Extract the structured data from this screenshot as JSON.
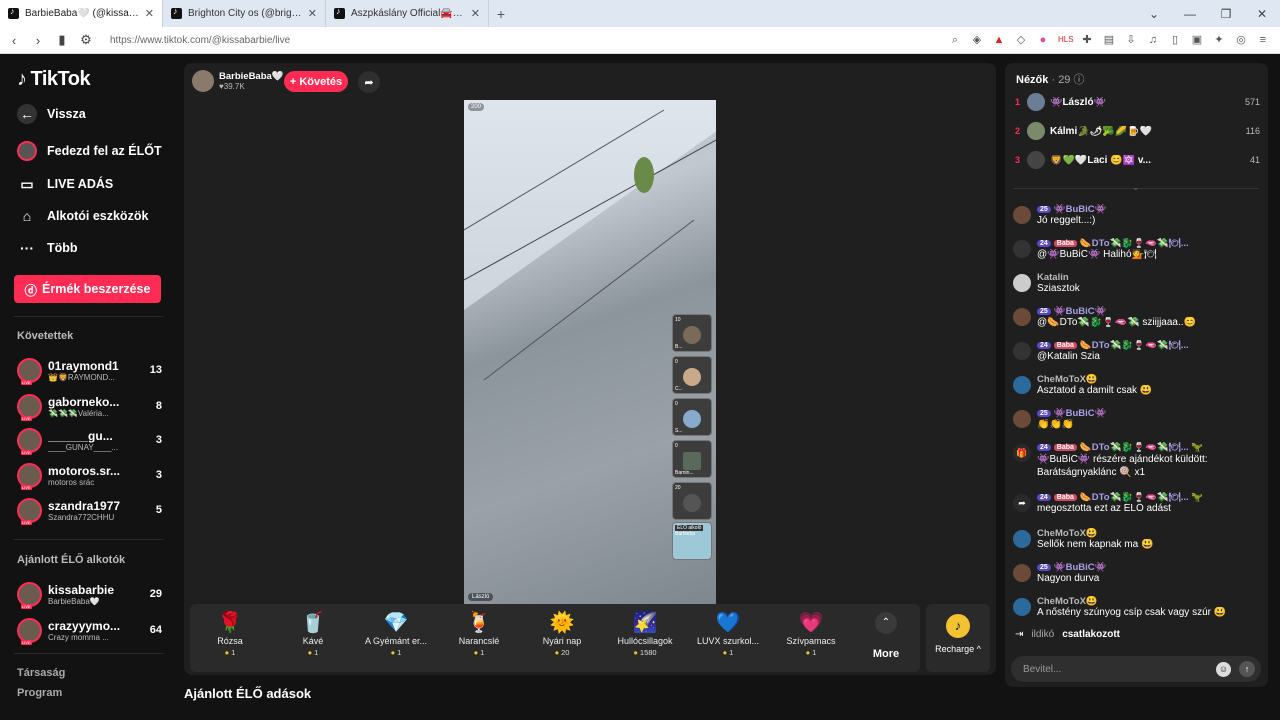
{
  "browser": {
    "tabs": [
      {
        "label": "BarbieBaba🤍 (@kissabarbie"
      },
      {
        "label": "Brighton City os (@brighton.city) ÉLŐ"
      },
      {
        "label": "Aszpkáslány Official🚘✖️ (@theresi"
      }
    ],
    "new_tab": "+",
    "url": "https://www.tiktok.com/@kissabarbie/live"
  },
  "sidebar": {
    "logo": "TikTok",
    "back": "Vissza",
    "nav": [
      {
        "label": "Fedezd fel az ÉLŐT",
        "icon": "live-explore-icon"
      },
      {
        "label": "LIVE ADÁS",
        "icon": "video-camera-icon"
      },
      {
        "label": "Alkotói eszközök",
        "icon": "creator-tools-icon"
      },
      {
        "label": "Több",
        "icon": "more-dots-icon"
      }
    ],
    "coin_button": "Érmék beszerzése",
    "following_title": "Követettek",
    "following": [
      {
        "name": "01raymond1",
        "sub": "👑🦁RAYMOND...",
        "count": "13"
      },
      {
        "name": "gaborneko...",
        "sub": "💸💸💸Valéria...",
        "count": "8"
      },
      {
        "name": "______gu...",
        "sub": "____GUNAY____...",
        "count": "3"
      },
      {
        "name": "motoros.sr...",
        "sub": "motoros srác",
        "count": "3"
      },
      {
        "name": "szandra1977",
        "sub": "Szandra772CHHU",
        "count": "5"
      }
    ],
    "recommended_title": "Ajánlott ÉLŐ alkotók",
    "recommended": [
      {
        "name": "kissabarbie",
        "sub": "BarbieBaba🤍",
        "count": "29"
      },
      {
        "name": "crazyyymo...",
        "sub": "Crazy momma ...",
        "count": "64"
      }
    ],
    "footer": [
      "Társaság",
      "Program"
    ]
  },
  "stream": {
    "host_name": "BarbieBaba🤍",
    "host_likes": "♥39.7K",
    "follow": "+ Követés",
    "video_badge": "200",
    "video_user": "László",
    "guests": [
      {
        "count": "10",
        "name": "B..."
      },
      {
        "count": "0",
        "name": "C..."
      },
      {
        "count": "0",
        "name": "S..."
      },
      {
        "count": "0",
        "name": "Barnin..."
      },
      {
        "count": "20",
        "name": ""
      },
      {
        "count": "",
        "name": "Barbieba"
      }
    ],
    "guest_extra": "ÉLŐ aikoló"
  },
  "gifts": [
    {
      "name": "Rózsa",
      "price": "1",
      "icon": "🌹"
    },
    {
      "name": "Kávé",
      "price": "1",
      "icon": "🥤"
    },
    {
      "name": "A Gyémánt er...",
      "price": "1",
      "icon": "💎"
    },
    {
      "name": "Narancslé",
      "price": "1",
      "icon": "🍹"
    },
    {
      "name": "Nyári nap",
      "price": "20",
      "icon": "🌞"
    },
    {
      "name": "Hullócsillagok",
      "price": "1580",
      "icon": "🌠"
    },
    {
      "name": "LUVX szurkol...",
      "price": "1",
      "icon": "💙"
    },
    {
      "name": "Szívpamacs",
      "price": "1",
      "icon": "💗"
    }
  ],
  "more_label": "More",
  "recharge_label": "Recharge ^",
  "bottom_title": "Ajánlott ÉLŐ adások",
  "panel": {
    "viewers_label": "Nézők",
    "viewers_count": "· 29",
    "ranking": [
      {
        "rank": "1",
        "name": "👾László👾",
        "value": "571"
      },
      {
        "rank": "2",
        "name": "Kálmi🐊🌶🥦🌽🍺🤍",
        "value": "116"
      },
      {
        "rank": "3",
        "name": "🦁💚🤍Laci 😊🔯 v...",
        "value": "41"
      }
    ],
    "messages": [
      {
        "level": "25",
        "user": "👾BuBiC👾",
        "text": "Jó reggelt...:)",
        "badge": ""
      },
      {
        "level": "24",
        "user": "🌭DTo💸🐉🍷🫦💸🍽...",
        "text": "@👾BuBiC👾 Halihó💁🍽",
        "badge": "Baba"
      },
      {
        "level": "",
        "user": "Katalin",
        "text": "Sziasztok",
        "badge": ""
      },
      {
        "level": "25",
        "user": "👾BuBiC👾",
        "text": "@🌭DTo💸🐉🍷🫦💸 sziijjaaa..😊",
        "badge": ""
      },
      {
        "level": "24",
        "user": "🌭DTo💸🐉🍷🫦💸🍽...",
        "text": "@Katalin Szia",
        "badge": "Baba"
      },
      {
        "level": "",
        "user": "CheMoToX😃",
        "text": "Ásztatod a damilt csak 😃",
        "badge": ""
      },
      {
        "level": "25",
        "user": "👾BuBiC👾",
        "text": "👏👏👏",
        "badge": ""
      },
      {
        "level": "24",
        "user": "🌭DTo💸🐉🍷🫦💸🍽... 🦖",
        "text": "👾BuBiC👾 részére ajándékot küldött: Barátságnyaklánc 🍭 x1",
        "badge": "Baba"
      },
      {
        "level": "24",
        "user": "🌭DTo💸🐉🍷🫦💸🍽... 🦖",
        "text": "megosztotta ezt az ÉLŐ adást",
        "badge": "Baba"
      },
      {
        "level": "",
        "user": "CheMoToX😃",
        "text": "Sellők nem kapnak ma 😃",
        "badge": ""
      },
      {
        "level": "25",
        "user": "👾BuBiC👾",
        "text": "Nagyon durva",
        "badge": ""
      },
      {
        "level": "",
        "user": "CheMoToX😃",
        "text": "A nőstény szúnyog csíp csak vagy szúr 😃",
        "badge": ""
      }
    ],
    "joined_name": "ildikó",
    "joined_action": "csatlakozott",
    "input_placeholder": "Bevitel..."
  }
}
